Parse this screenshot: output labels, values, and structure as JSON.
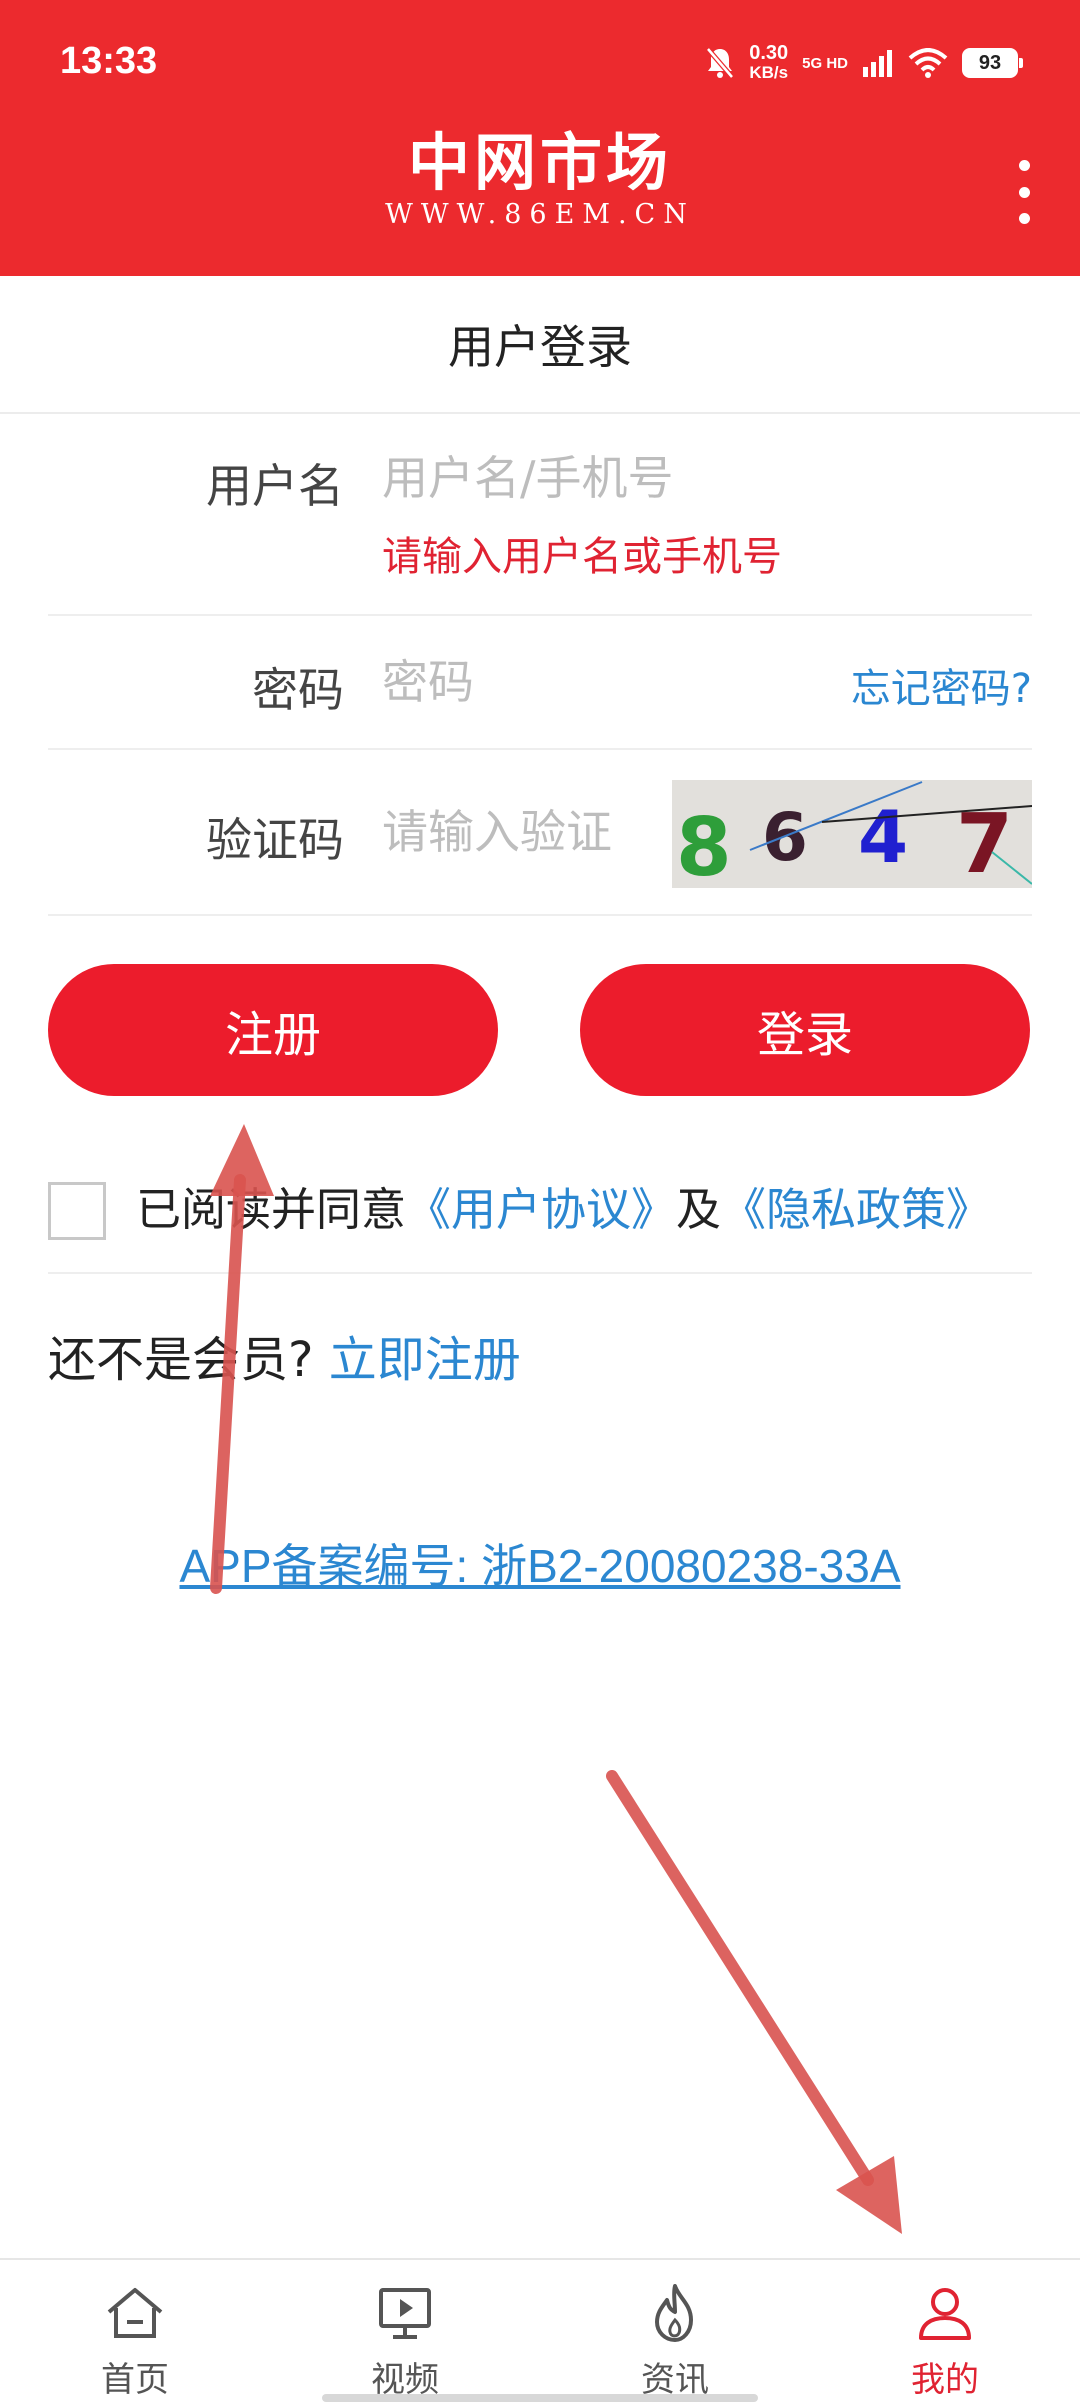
{
  "status_bar": {
    "time": "13:33",
    "speed_value": "0.30",
    "speed_unit": "KB/s",
    "network": "5G HD",
    "battery": "93"
  },
  "header": {
    "logo_title": "中网市场",
    "logo_subtitle": "WWW.86EM.CN"
  },
  "page_title": "用户登录",
  "form": {
    "username": {
      "label": "用户名",
      "placeholder": "用户名/手机号",
      "value": "",
      "error": "请输入用户名或手机号"
    },
    "password": {
      "label": "密码",
      "placeholder": "密码",
      "value": "",
      "forgot_label": "忘记密码?"
    },
    "captcha": {
      "label": "验证码",
      "placeholder": "请输入验证",
      "value": "",
      "code": "8647"
    }
  },
  "buttons": {
    "register": "注册",
    "login": "登录"
  },
  "agreement": {
    "prefix": "已阅读并同意",
    "user_agreement": "《用户协议》",
    "conjunction": "及",
    "privacy_policy": "《隐私政策》",
    "checked": false
  },
  "member_prompt": {
    "text": "还不是会员?",
    "link": "立即注册"
  },
  "icp": "APP备案编号: 浙B2-20080238-33A",
  "bottom_nav": [
    {
      "label": "首页",
      "icon": "home-icon",
      "active": false
    },
    {
      "label": "视频",
      "icon": "video-icon",
      "active": false
    },
    {
      "label": "资讯",
      "icon": "flame-icon",
      "active": false
    },
    {
      "label": "我的",
      "icon": "user-icon",
      "active": true
    }
  ],
  "colors": {
    "brand_red": "#ec2a2e",
    "button_red": "#ec1c2c",
    "link_blue": "#2b87d1",
    "error_red": "#e02332",
    "annotation_arrow": "#d9534f"
  }
}
